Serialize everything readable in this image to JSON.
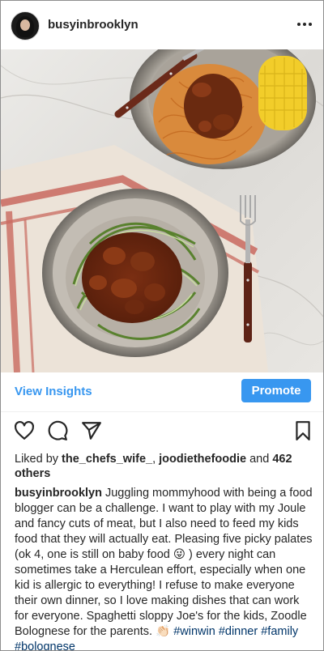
{
  "header": {
    "username": "busyinbrooklyn",
    "more_icon": "more-horizontal-icon"
  },
  "photo": {
    "alt_subject": "zucchini noodles and spaghetti bolognese"
  },
  "insights": {
    "view_label": "View Insights",
    "promote_label": "Promote"
  },
  "actions": {
    "like_icon": "heart-icon",
    "comment_icon": "comment-icon",
    "share_icon": "send-icon",
    "save_icon": "bookmark-icon"
  },
  "likes": {
    "prefix": "Liked by ",
    "user1": "the_chefs_wife_",
    "sep": ", ",
    "user2": "joodiethefoodie",
    "and": " and ",
    "others": "462 others"
  },
  "caption": {
    "username": "busyinbrooklyn",
    "text": " Juggling mommyhood with being a food blogger can be a challenge. I want to play with my Joule and fancy cuts of meat, but I also need to feed my kids food that they will actually eat. Pleasing five picky palates (ok 4, one is still on baby food 😜 ) every night can sometimes take a Herculean effort, especially when one kid is allergic to everything! I refuse to make everyone their own dinner, so I love making dishes that can work for everyone. Spaghetti sloppy Joe's for the kids, Zoodle Bolognese for the parents. 👏🏻 ",
    "hashtags": [
      "#winwin",
      "#dinner",
      "#family",
      "#bolognese"
    ]
  },
  "colors": {
    "link": "#3897f0",
    "hashtag": "#003569",
    "text": "#262626"
  }
}
